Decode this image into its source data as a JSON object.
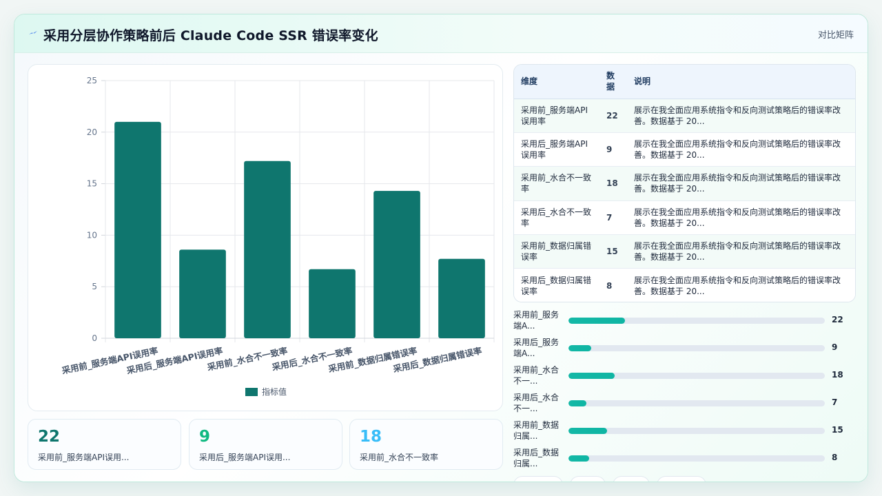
{
  "header": {
    "title": "采用分层协作策略前后 Claude Code SSR 错误率变化",
    "tag": "对比矩阵"
  },
  "colors": {
    "bar": "#0f766e",
    "kpi_1": "#0f766e",
    "kpi_2": "#10b981",
    "kpi_3": "#38bdf8"
  },
  "chart_data": {
    "type": "bar",
    "categories": [
      "采用前_服务端API误用率",
      "采用后_服务端API误用率",
      "采用前_水合不一致率",
      "采用后_水合不一致率",
      "采用前_数据归属错误率",
      "采用后_数据归属错误率"
    ],
    "series": [
      {
        "name": "指标值",
        "values": [
          21,
          8.6,
          17.2,
          6.7,
          14.3,
          7.7
        ]
      }
    ],
    "ylim": [
      0,
      25
    ],
    "yticks": [
      0,
      5,
      10,
      15,
      20,
      25
    ],
    "grid": true,
    "legend": "bottom"
  },
  "kpis": [
    {
      "value": "22",
      "label": "采用前_服务端API误用..."
    },
    {
      "value": "9",
      "label": "采用后_服务端API误用..."
    },
    {
      "value": "18",
      "label": "采用前_水合不一致率"
    }
  ],
  "table": {
    "headers": [
      "维度",
      "数据",
      "说明"
    ],
    "rows": [
      {
        "dim": "采用前_服务端API误用率",
        "val": "22",
        "desc": "展示在我全面应用系统指令和反向测试策略后的错误率改善。数据基于 20..."
      },
      {
        "dim": "采用后_服务端API误用率",
        "val": "9",
        "desc": "展示在我全面应用系统指令和反向测试策略后的错误率改善。数据基于 20..."
      },
      {
        "dim": "采用前_水合不一致率",
        "val": "18",
        "desc": "展示在我全面应用系统指令和反向测试策略后的错误率改善。数据基于 20..."
      },
      {
        "dim": "采用后_水合不一致率",
        "val": "7",
        "desc": "展示在我全面应用系统指令和反向测试策略后的错误率改善。数据基于 20..."
      },
      {
        "dim": "采用前_数据归属错误率",
        "val": "15",
        "desc": "展示在我全面应用系统指令和反向测试策略后的错误率改善。数据基于 20..."
      },
      {
        "dim": "采用后_数据归属错误率",
        "val": "8",
        "desc": "展示在我全面应用系统指令和反向测试策略后的错误率改善。数据基于 20..."
      }
    ]
  },
  "progress": {
    "max": 100,
    "items": [
      {
        "label": "采用前_服务端A...",
        "value": 22
      },
      {
        "label": "采用后_服务端A...",
        "value": 9
      },
      {
        "label": "采用前_水合不一...",
        "value": 18
      },
      {
        "label": "采用后_水合不一...",
        "value": 7
      },
      {
        "label": "采用前_数据归属...",
        "value": 15
      },
      {
        "label": "采用后_数据归属...",
        "value": 8
      }
    ]
  }
}
